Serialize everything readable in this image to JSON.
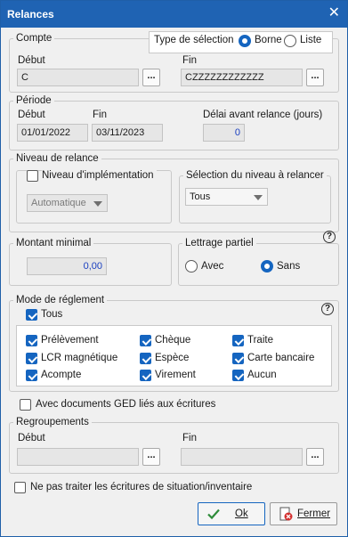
{
  "window": {
    "title": "Relances",
    "close_glyph": "✕"
  },
  "compte": {
    "legend": "Compte",
    "selection": {
      "label": "Type de sélection",
      "options": [
        "Borne",
        "Liste"
      ],
      "selected": "Borne"
    },
    "debut_label": "Début",
    "debut_value": "C",
    "fin_label": "Fin",
    "fin_value": "CZZZZZZZZZZZZ"
  },
  "periode": {
    "legend": "Période",
    "debut_label": "Début",
    "debut_value": "01/01/2022",
    "fin_label": "Fin",
    "fin_value": "03/11/2023",
    "delai_label": "Délai avant relance (jours)",
    "delai_value": "0"
  },
  "niveau": {
    "legend": "Niveau de relance",
    "impl_label": "Niveau d'implémentation",
    "impl_checked": false,
    "impl_select": "Automatique",
    "sel_legend": "Sélection du niveau à relancer",
    "sel_value": "Tous"
  },
  "montant": {
    "legend": "Montant minimal",
    "value": "0,00"
  },
  "lettrage": {
    "legend": "Lettrage partiel",
    "options": [
      "Avec",
      "Sans"
    ],
    "selected": "Sans",
    "help_glyph": "?"
  },
  "reglement": {
    "legend": "Mode de réglement",
    "help_glyph": "?",
    "tous_label": "Tous",
    "tous_checked": true,
    "modes": [
      {
        "label": "Prélèvement",
        "checked": true
      },
      {
        "label": "Chèque",
        "checked": true
      },
      {
        "label": "Traite",
        "checked": true
      },
      {
        "label": "LCR magnétique",
        "checked": true
      },
      {
        "label": "Espèce",
        "checked": true
      },
      {
        "label": "Carte bancaire",
        "checked": true
      },
      {
        "label": "Acompte",
        "checked": true
      },
      {
        "label": "Virement",
        "checked": true
      },
      {
        "label": "Aucun",
        "checked": true
      }
    ]
  },
  "ged": {
    "label": "Avec documents GED liés aux écritures",
    "checked": false
  },
  "regroupements": {
    "legend": "Regroupements",
    "debut_label": "Début",
    "debut_value": "",
    "fin_label": "Fin",
    "fin_value": ""
  },
  "situation": {
    "label": "Ne pas traiter les écritures de situation/inventaire",
    "checked": false
  },
  "buttons": {
    "ok": "Ok",
    "fermer": "Fermer"
  },
  "dots_label": "...",
  "colors": {
    "accent": "#1565c0",
    "titlebar": "#1f63b3"
  }
}
